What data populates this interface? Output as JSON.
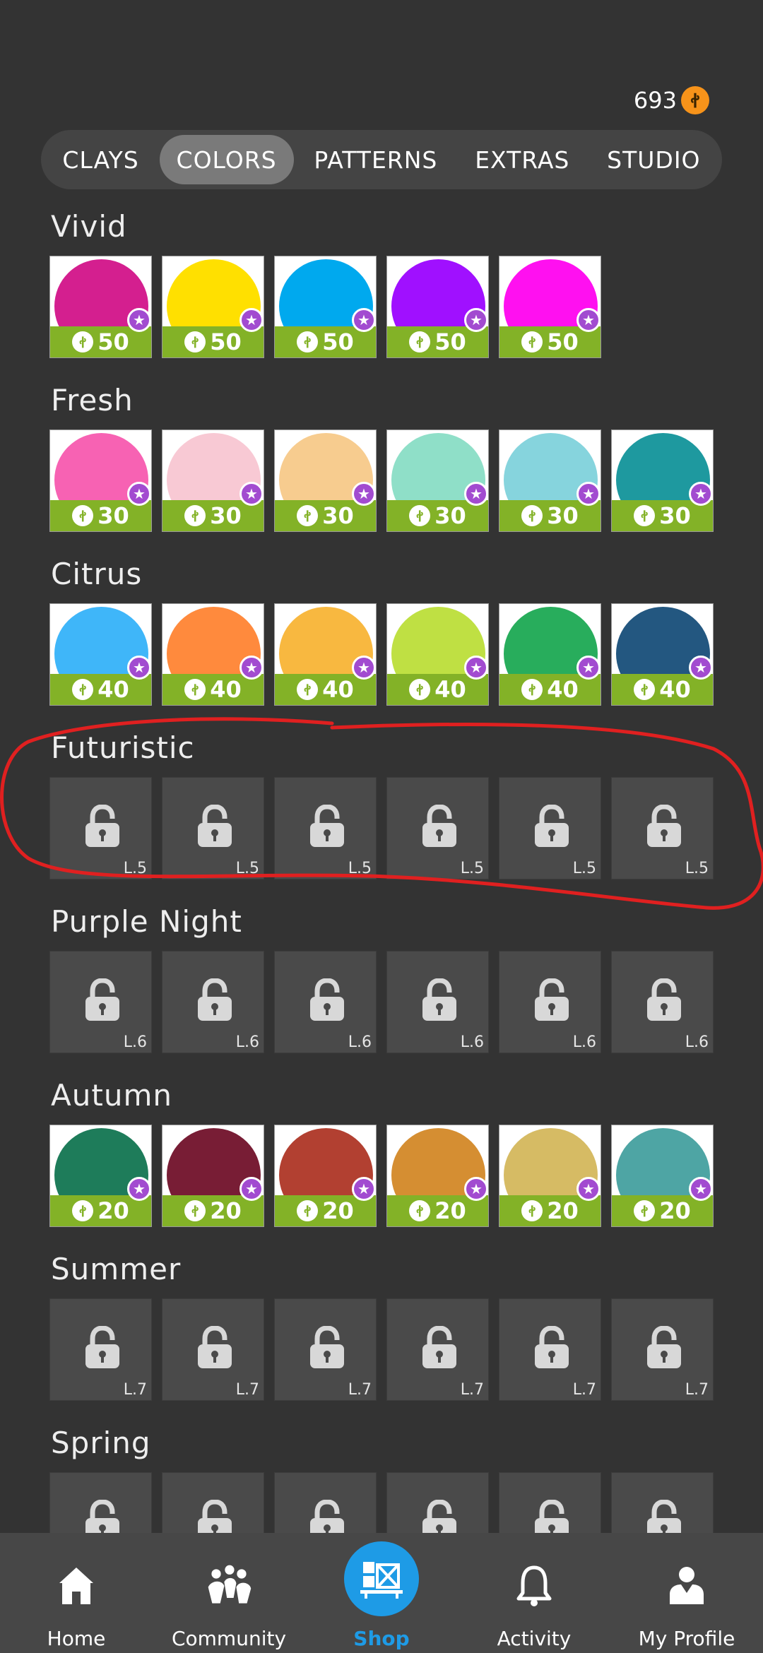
{
  "currency": {
    "amount": "693",
    "coin_symbol": "ꬷ"
  },
  "tabs": [
    {
      "label": "CLAYS",
      "active": false
    },
    {
      "label": "COLORS",
      "active": true
    },
    {
      "label": "PATTERNS",
      "active": false
    },
    {
      "label": "EXTRAS",
      "active": false
    },
    {
      "label": "STUDIO",
      "active": false
    }
  ],
  "sections": [
    {
      "title": "Vivid",
      "locked": false,
      "items": [
        {
          "color": "#d41f8f",
          "price": "50"
        },
        {
          "color": "#ffe000",
          "price": "50"
        },
        {
          "color": "#00a9ee",
          "price": "50"
        },
        {
          "color": "#a010ff",
          "price": "50"
        },
        {
          "color": "#ff10f0",
          "price": "50"
        }
      ]
    },
    {
      "title": "Fresh",
      "locked": false,
      "items": [
        {
          "color": "#f762b3",
          "price": "30"
        },
        {
          "color": "#f8c9d4",
          "price": "30"
        },
        {
          "color": "#f7cc8f",
          "price": "30"
        },
        {
          "color": "#8fdfc8",
          "price": "30"
        },
        {
          "color": "#86d4dd",
          "price": "30"
        },
        {
          "color": "#1e999f",
          "price": "30"
        }
      ]
    },
    {
      "title": "Citrus",
      "locked": false,
      "items": [
        {
          "color": "#3fb6f9",
          "price": "40"
        },
        {
          "color": "#ff8a3d",
          "price": "40"
        },
        {
          "color": "#f8b840",
          "price": "40"
        },
        {
          "color": "#bfe043",
          "price": "40"
        },
        {
          "color": "#28ad5c",
          "price": "40"
        },
        {
          "color": "#235780",
          "price": "40"
        }
      ]
    },
    {
      "title": "Futuristic",
      "locked": true,
      "items": [
        {
          "level": "L.5"
        },
        {
          "level": "L.5"
        },
        {
          "level": "L.5"
        },
        {
          "level": "L.5"
        },
        {
          "level": "L.5"
        },
        {
          "level": "L.5"
        }
      ]
    },
    {
      "title": "Purple Night",
      "locked": true,
      "items": [
        {
          "level": "L.6"
        },
        {
          "level": "L.6"
        },
        {
          "level": "L.6"
        },
        {
          "level": "L.6"
        },
        {
          "level": "L.6"
        },
        {
          "level": "L.6"
        }
      ]
    },
    {
      "title": "Autumn",
      "locked": false,
      "items": [
        {
          "color": "#1e7c5a",
          "price": "20"
        },
        {
          "color": "#781d35",
          "price": "20"
        },
        {
          "color": "#b24031",
          "price": "20"
        },
        {
          "color": "#d58e32",
          "price": "20"
        },
        {
          "color": "#d6bb64",
          "price": "20"
        },
        {
          "color": "#4ea5a4",
          "price": "20"
        }
      ]
    },
    {
      "title": "Summer",
      "locked": true,
      "items": [
        {
          "level": "L.7"
        },
        {
          "level": "L.7"
        },
        {
          "level": "L.7"
        },
        {
          "level": "L.7"
        },
        {
          "level": "L.7"
        },
        {
          "level": "L.7"
        }
      ]
    },
    {
      "title": "Spring",
      "locked": true,
      "items": [
        {
          "level": ""
        },
        {
          "level": ""
        },
        {
          "level": ""
        },
        {
          "level": ""
        },
        {
          "level": ""
        },
        {
          "level": ""
        }
      ]
    }
  ],
  "nav": [
    {
      "label": "Home",
      "icon": "home-icon",
      "active": false
    },
    {
      "label": "Community",
      "icon": "community-icon",
      "active": false
    },
    {
      "label": "Shop",
      "icon": "shop-icon",
      "active": true
    },
    {
      "label": "Activity",
      "icon": "bell-icon",
      "active": false
    },
    {
      "label": "My Profile",
      "icon": "profile-icon",
      "active": false
    }
  ],
  "colors": {
    "accent": "#1e9be6",
    "price_green": "#83b227",
    "star_purple": "#a24bd0",
    "annotation_red": "#e02020"
  }
}
